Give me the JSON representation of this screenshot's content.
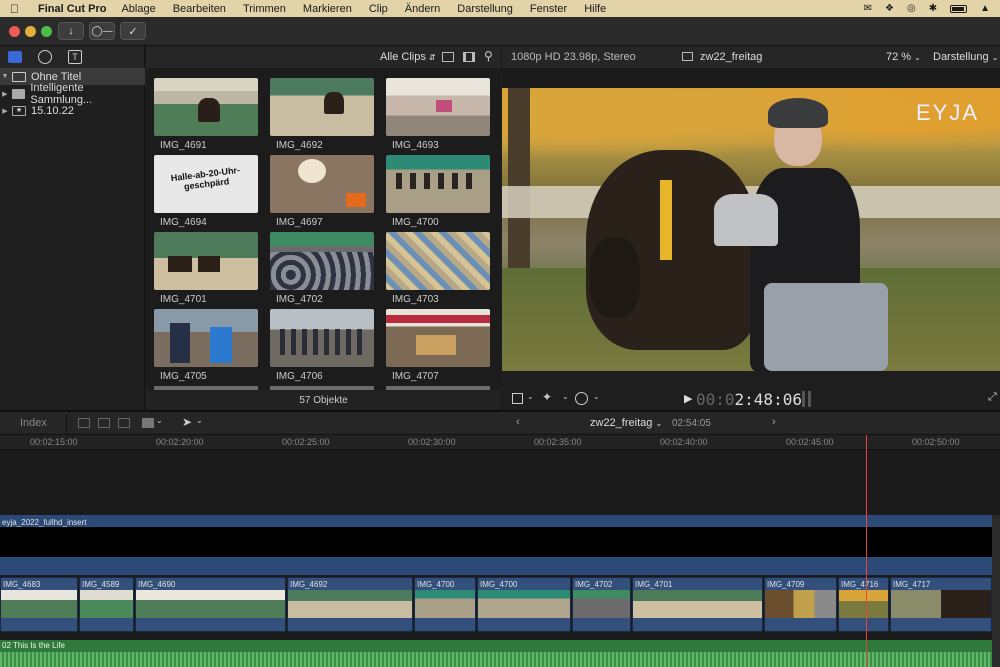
{
  "menubar": {
    "app": "Final Cut Pro",
    "items": [
      "Ablage",
      "Bearbeiten",
      "Trimmen",
      "Markieren",
      "Clip",
      "Ändern",
      "Darstellung",
      "Fenster",
      "Hilfe"
    ]
  },
  "library": {
    "rows": [
      {
        "label": "Ohne Titel",
        "selected": true
      },
      {
        "label": "Intelligente Sammlung...",
        "selected": false
      },
      {
        "label": "15.10.22",
        "selected": false
      }
    ]
  },
  "browser": {
    "filter_label": "Alle Clips",
    "clips": [
      {
        "name": "IMG_4691"
      },
      {
        "name": "IMG_4692"
      },
      {
        "name": "IMG_4693"
      },
      {
        "name": "IMG_4694"
      },
      {
        "name": "IMG_4697"
      },
      {
        "name": "IMG_4700"
      },
      {
        "name": "IMG_4701"
      },
      {
        "name": "IMG_4702"
      },
      {
        "name": "IMG_4703"
      },
      {
        "name": "IMG_4705"
      },
      {
        "name": "IMG_4706"
      },
      {
        "name": "IMG_4707"
      }
    ],
    "sign_text": "Halle-ab-20-Uhr-geschpärd",
    "count_label": "57 Objekte"
  },
  "viewer": {
    "format": "1080p HD 23.98p, Stereo",
    "project": "zw22_freitag",
    "zoom": "72 %",
    "view_menu": "Darstellung",
    "watermark": "EYJA",
    "timecode_dim": "00:0",
    "timecode": "2:48:06"
  },
  "timeline": {
    "index_label": "Index",
    "project": "zw22_freitag",
    "duration": "02:54:05",
    "ticks": [
      "00:02:15:00",
      "00:02:20:00",
      "00:02:25:00",
      "00:02:30:00",
      "00:02:35:00",
      "00:02:40:00",
      "00:02:45:00",
      "00:02:50:00"
    ],
    "connected_clip": "eyja_2022_fullhd_insert",
    "clips": [
      "IMG_4683",
      "IMG_4589",
      "IMG_4690",
      "IMG_4692",
      "IMG_4700",
      "IMG_4700",
      "IMG_4702",
      "IMG_4701",
      "IMG_4709",
      "IMG_4716",
      "IMG_4717"
    ],
    "audio_clip": "02 This Is the Life"
  },
  "colors": {
    "playhead": "#e8453c",
    "primary_clip": "#334f7c",
    "audio": "#2f7a3a"
  }
}
